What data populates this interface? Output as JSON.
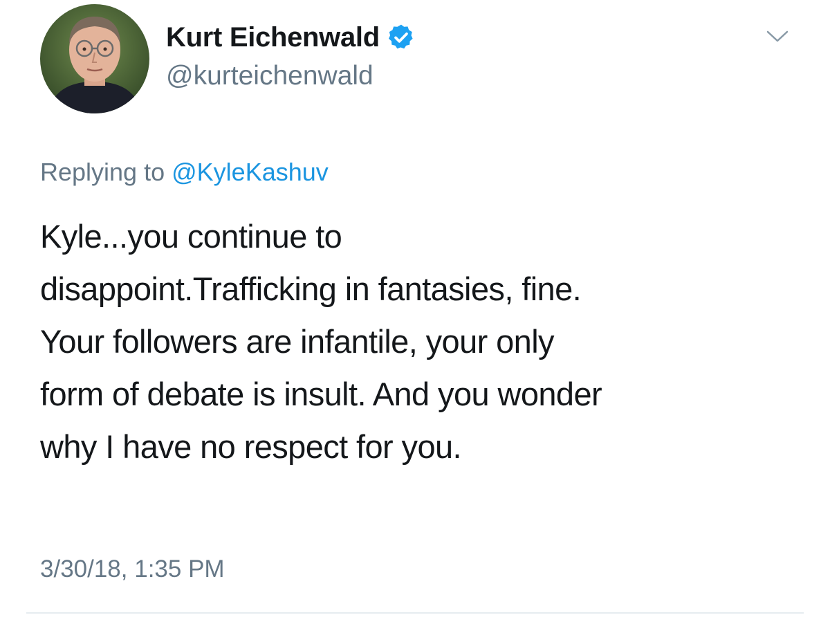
{
  "author": {
    "display_name": "Kurt Eichenwald",
    "handle": "@kurteichenwald",
    "avatar_icon": "avatar-photo",
    "verified_icon": "verified-badge-icon"
  },
  "tweet": {
    "reply_prefix": "Replying to",
    "reply_to": "@KyleKashuv",
    "text": "Kyle...you continue to\ndisappoint.Trafficking in fantasies, fine.\nYour followers are infantile, your only\nform of debate is insult. And you wonder\nwhy I have no respect for you.",
    "timestamp": "3/30/18, 1:35 PM"
  },
  "colors": {
    "primary_text": "#14171a",
    "secondary_text": "#657786",
    "link": "#1b95e0",
    "verified": "#1da1f2",
    "divider": "#e6ecf0"
  },
  "icons": {
    "menu": "chevron-down-icon"
  }
}
